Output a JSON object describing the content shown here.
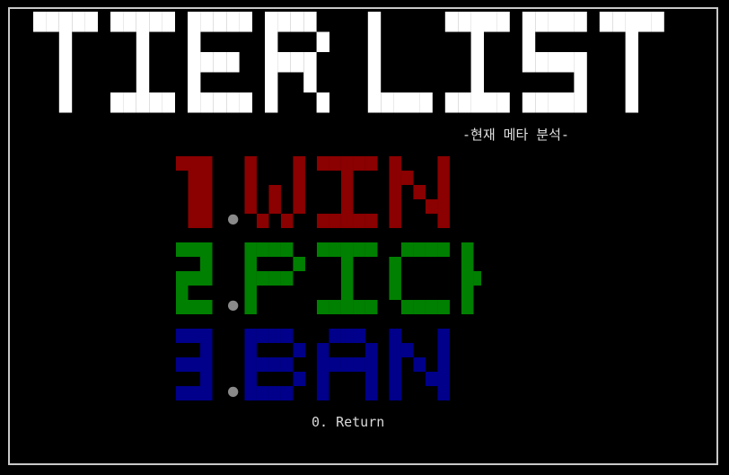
{
  "screen": {
    "background": "#000000",
    "border_color": "#c8c8c8"
  },
  "title": {
    "text": "TIER LIST",
    "color": "#ffffff"
  },
  "subtitle": {
    "text": "-현재 메타 분석-",
    "color": "#e0e0e0"
  },
  "menu": [
    {
      "number": "1",
      "label": "WIN",
      "text": "1.WIN",
      "color": "#8b0000"
    },
    {
      "number": "2",
      "label": "PICK",
      "text": "2.PICK",
      "color": "#008000"
    },
    {
      "number": "3",
      "label": "BAN",
      "text": "3.BAN",
      "color": "#00008b"
    }
  ],
  "dot_color": "#8a8a8a",
  "return_option": {
    "text": "0. Return",
    "color": "#d9d9d9"
  }
}
